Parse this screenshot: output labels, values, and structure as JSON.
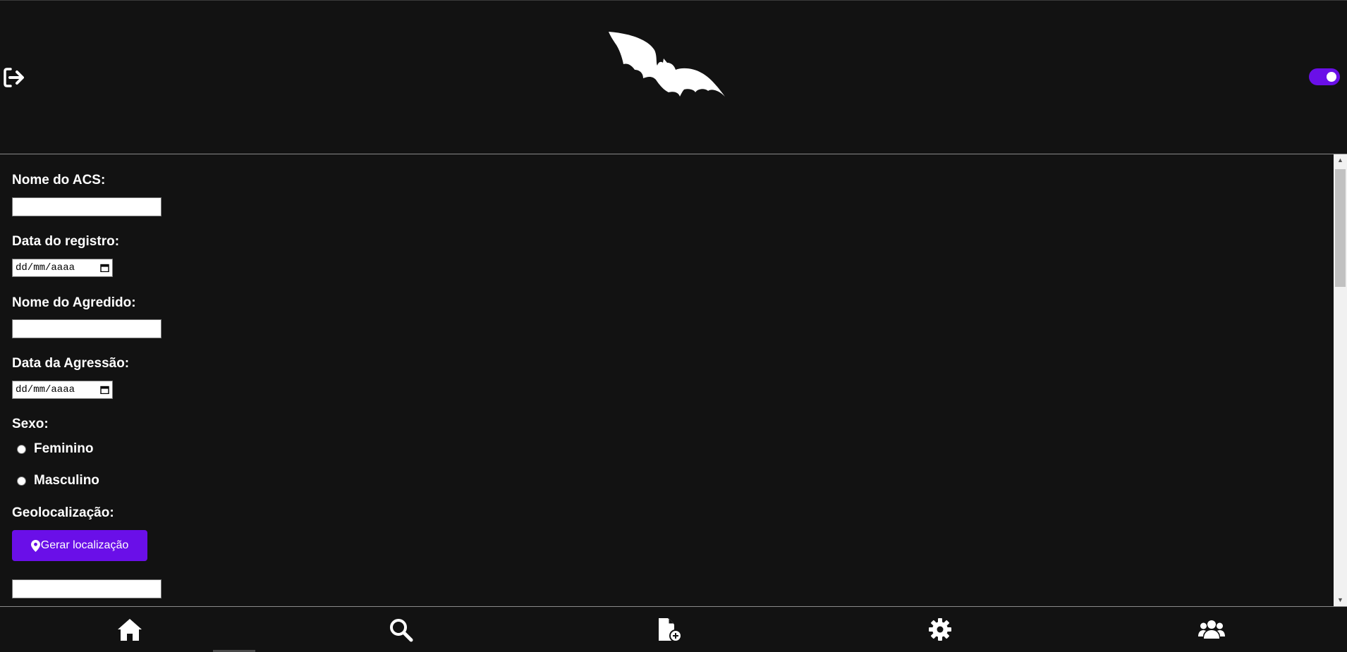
{
  "header": {
    "logout_icon": "logout-icon",
    "logo_icon": "bat-logo",
    "theme_toggle": {
      "state": "on",
      "color": "#6a0fe8"
    }
  },
  "form": {
    "acs_name": {
      "label": "Nome do ACS:",
      "value": ""
    },
    "record_date": {
      "label": "Data do registro:",
      "placeholder": "dd/mm/aaaa"
    },
    "victim_name": {
      "label": "Nome do Agredido:",
      "value": ""
    },
    "aggression_date": {
      "label": "Data da Agressão:",
      "placeholder": "dd/mm/aaaa"
    },
    "sex": {
      "label": "Sexo:",
      "options": [
        "Feminino",
        "Masculino"
      ],
      "selected": null
    },
    "geolocation": {
      "label": "Geolocalização:",
      "button_label": "Gerar localização",
      "button_icon": "map-pin-icon",
      "value": ""
    }
  },
  "bottom_nav": {
    "items": [
      "home-icon",
      "search-icon",
      "add-file-icon",
      "gear-icon",
      "users-icon"
    ]
  },
  "colors": {
    "background": "#121212",
    "accent": "#6a0fe8",
    "text": "#ffffff"
  }
}
